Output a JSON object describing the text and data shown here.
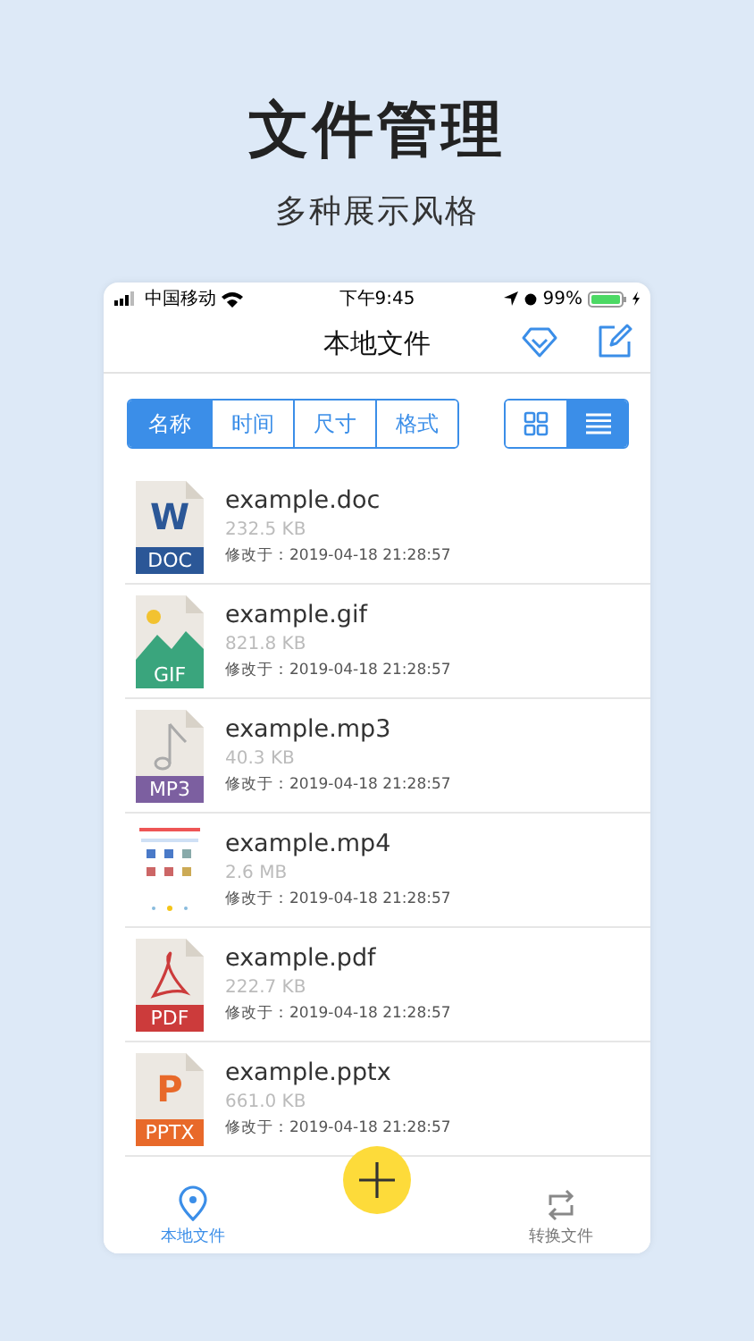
{
  "headline": "文件管理",
  "subheadline": "多种展示风格",
  "status_bar": {
    "carrier": "中国移动",
    "time": "下午9:45",
    "battery": "99%"
  },
  "nav": {
    "title": "本地文件"
  },
  "sort_tabs": [
    {
      "label": "名称",
      "selected": true
    },
    {
      "label": "时间",
      "selected": false
    },
    {
      "label": "尺寸",
      "selected": false
    },
    {
      "label": "格式",
      "selected": false
    }
  ],
  "view_toggle": [
    {
      "kind": "grid",
      "selected": false
    },
    {
      "kind": "list",
      "selected": true
    }
  ],
  "files": [
    {
      "kind": "doc",
      "glyph": "W",
      "badge": "DOC",
      "name": "example.doc",
      "size": "232.5 KB",
      "modified": "修改于：2019-04-18 21:28:57"
    },
    {
      "kind": "gif",
      "badge": "GIF",
      "name": "example.gif",
      "size": "821.8 KB",
      "modified": "修改于：2019-04-18 21:28:57"
    },
    {
      "kind": "mp3",
      "badge": "MP3",
      "name": "example.mp3",
      "size": "40.3 KB",
      "modified": "修改于：2019-04-18 21:28:57"
    },
    {
      "kind": "video",
      "name": "example.mp4",
      "size": "2.6 MB",
      "modified": "修改于：2019-04-18 21:28:57"
    },
    {
      "kind": "pdf",
      "badge": "PDF",
      "name": "example.pdf",
      "size": "222.7 KB",
      "modified": "修改于：2019-04-18 21:28:57"
    },
    {
      "kind": "pptx",
      "glyph": "P",
      "badge": "PPTX",
      "name": "example.pptx",
      "size": "661.0 KB",
      "modified": "修改于：2019-04-18 21:28:57"
    }
  ],
  "tab_bar": [
    {
      "kind": "local",
      "label": "本地文件",
      "selected": true
    },
    {
      "kind": "convert",
      "label": "转换文件",
      "selected": false
    }
  ]
}
